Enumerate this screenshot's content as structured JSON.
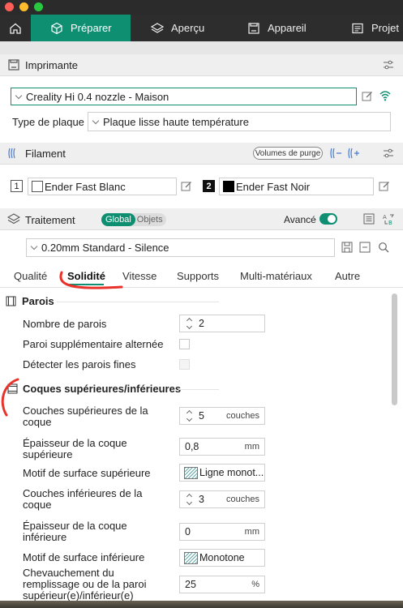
{
  "window": {
    "buttons": {
      "close": "#fe5f57",
      "minimize": "#febc2e",
      "maximize": "#28c840"
    }
  },
  "tabs": [
    {
      "label": "Préparer",
      "active": true
    },
    {
      "label": "Aperçu",
      "active": false
    },
    {
      "label": "Appareil",
      "active": false
    },
    {
      "label": "Projet",
      "active": false
    }
  ],
  "printer": {
    "section_title": "Imprimante",
    "selected": "Creality Hi 0.4 nozzle - Maison",
    "plate_label": "Type de plaque",
    "plate_value": "Plaque lisse haute température"
  },
  "filament": {
    "section_title": "Filament",
    "purge_button": "Volumes de purge",
    "slots": [
      {
        "index": "1",
        "name": "Ender Fast Blanc",
        "color": "#ffffff"
      },
      {
        "index": "2",
        "name": "Ender Fast Noir",
        "color": "#000000"
      }
    ]
  },
  "process": {
    "section_title": "Traitement",
    "toggle_global": "Global",
    "toggle_objects": "Objets",
    "advanced_label": "Avancé",
    "advanced_on": true,
    "profile": "0.20mm Standard - Silence",
    "subtabs": [
      "Qualité",
      "Solidité",
      "Vitesse",
      "Supports",
      "Multi-matériaux",
      "Autre"
    ],
    "active_subtab": "Solidité"
  },
  "groups": {
    "walls": {
      "title": "Parois",
      "wall_count_label": "Nombre de parois",
      "wall_count_value": "2",
      "alt_wall_label": "Paroi supplémentaire alternée",
      "thin_walls_label": "Détecter les parois fines"
    },
    "shells": {
      "title": "Coques supérieures/inférieures",
      "top_layers_label": "Couches supérieures de la coque",
      "top_layers_value": "5",
      "top_layers_unit": "couches",
      "top_thickness_label": "Épaisseur de la coque supérieure",
      "top_thickness_value": "0,8",
      "top_thickness_unit": "mm",
      "top_pattern_label": "Motif de surface supérieure",
      "top_pattern_value": "Ligne monot...",
      "bottom_layers_label": "Couches inférieures de la coque",
      "bottom_layers_value": "3",
      "bottom_layers_unit": "couches",
      "bottom_thickness_label": "Épaisseur de la coque inférieure",
      "bottom_thickness_value": "0",
      "bottom_thickness_unit": "mm",
      "bottom_pattern_label": "Motif de surface inférieure",
      "bottom_pattern_value": "Monotone",
      "overlap_label": "Chevauchement du remplissage ou de la paroi supérieur(e)/inférieur(e)",
      "overlap_value": "25",
      "overlap_unit": "%"
    }
  },
  "accent_color": "#0f8f72",
  "annotation_color": "#e8322a"
}
